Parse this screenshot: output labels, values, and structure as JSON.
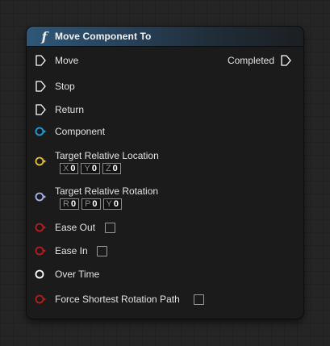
{
  "node": {
    "title": "Move Component To",
    "function_icon": "function-f-icon"
  },
  "pins": {
    "move": "Move",
    "stop": "Stop",
    "return": "Return",
    "component": "Component",
    "target_location": "Target Relative Location",
    "target_rotation": "Target Relative Rotation",
    "ease_out": "Ease Out",
    "ease_in": "Ease In",
    "over_time": "Over Time",
    "force_shortest": "Force Shortest Rotation Path",
    "completed": "Completed"
  },
  "location": {
    "x_label": "X",
    "x_value": "0",
    "y_label": "Y",
    "y_value": "0",
    "z_label": "Z",
    "z_value": "0"
  },
  "rotation": {
    "r_label": "R",
    "r_value": "0",
    "p_label": "P",
    "p_value": "0",
    "y_label": "Y",
    "y_value": "0"
  },
  "checkboxes": {
    "ease_out_checked": false,
    "ease_in_checked": false,
    "force_shortest_checked": false
  },
  "colors": {
    "exec": "#ffffff",
    "object": "#1e9fd9",
    "vector": "#e8c13a",
    "rotator": "#a9b3ee",
    "bool": "#b81c1c",
    "float": "#ffffff",
    "header_accent": "#2f5777"
  }
}
